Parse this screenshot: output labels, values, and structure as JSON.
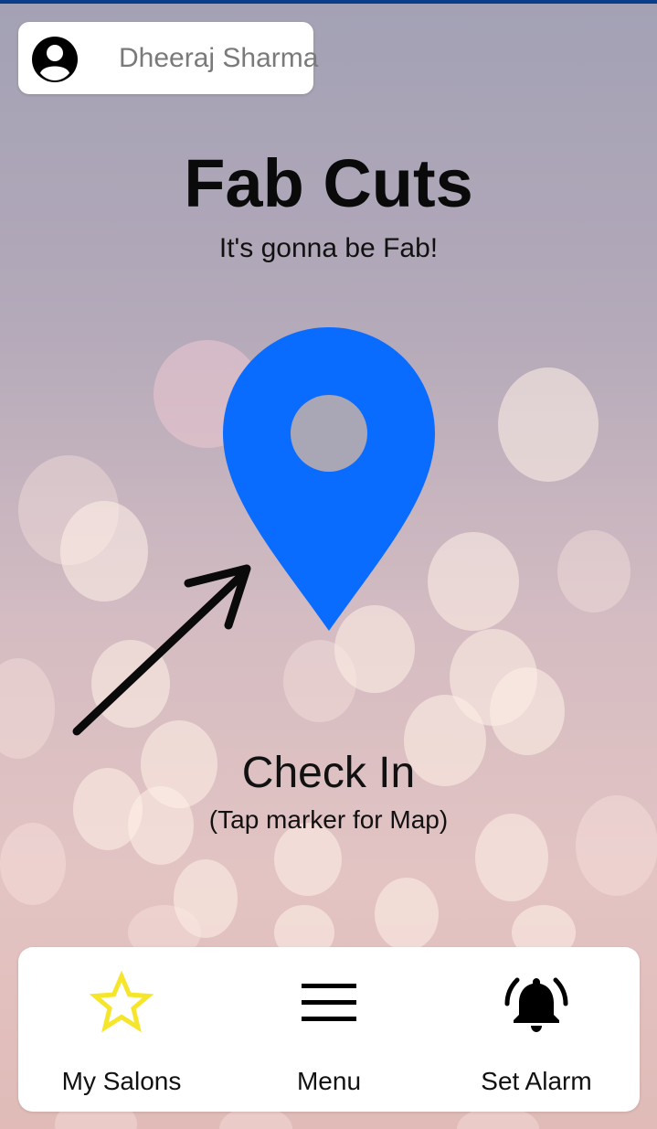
{
  "user": {
    "name": "Dheeraj Sharma",
    "avatar_icon": "account-circle-icon"
  },
  "header": {
    "title": "Fab Cuts",
    "tagline": "It's gonna be Fab!"
  },
  "main": {
    "marker_icon": "location-pin-icon",
    "marker_color": "#0a6cff",
    "arrow_icon": "arrow-up-right-icon",
    "checkin_label": "Check In",
    "hint": "(Tap marker for Map)"
  },
  "bottom_nav": {
    "items": [
      {
        "label": "My Salons",
        "icon": "star-outline-icon",
        "icon_color": "#f5e52b"
      },
      {
        "label": "Menu",
        "icon": "menu-icon",
        "icon_color": "#000000"
      },
      {
        "label": "Set Alarm",
        "icon": "bell-ringing-icon",
        "icon_color": "#000000"
      }
    ]
  }
}
